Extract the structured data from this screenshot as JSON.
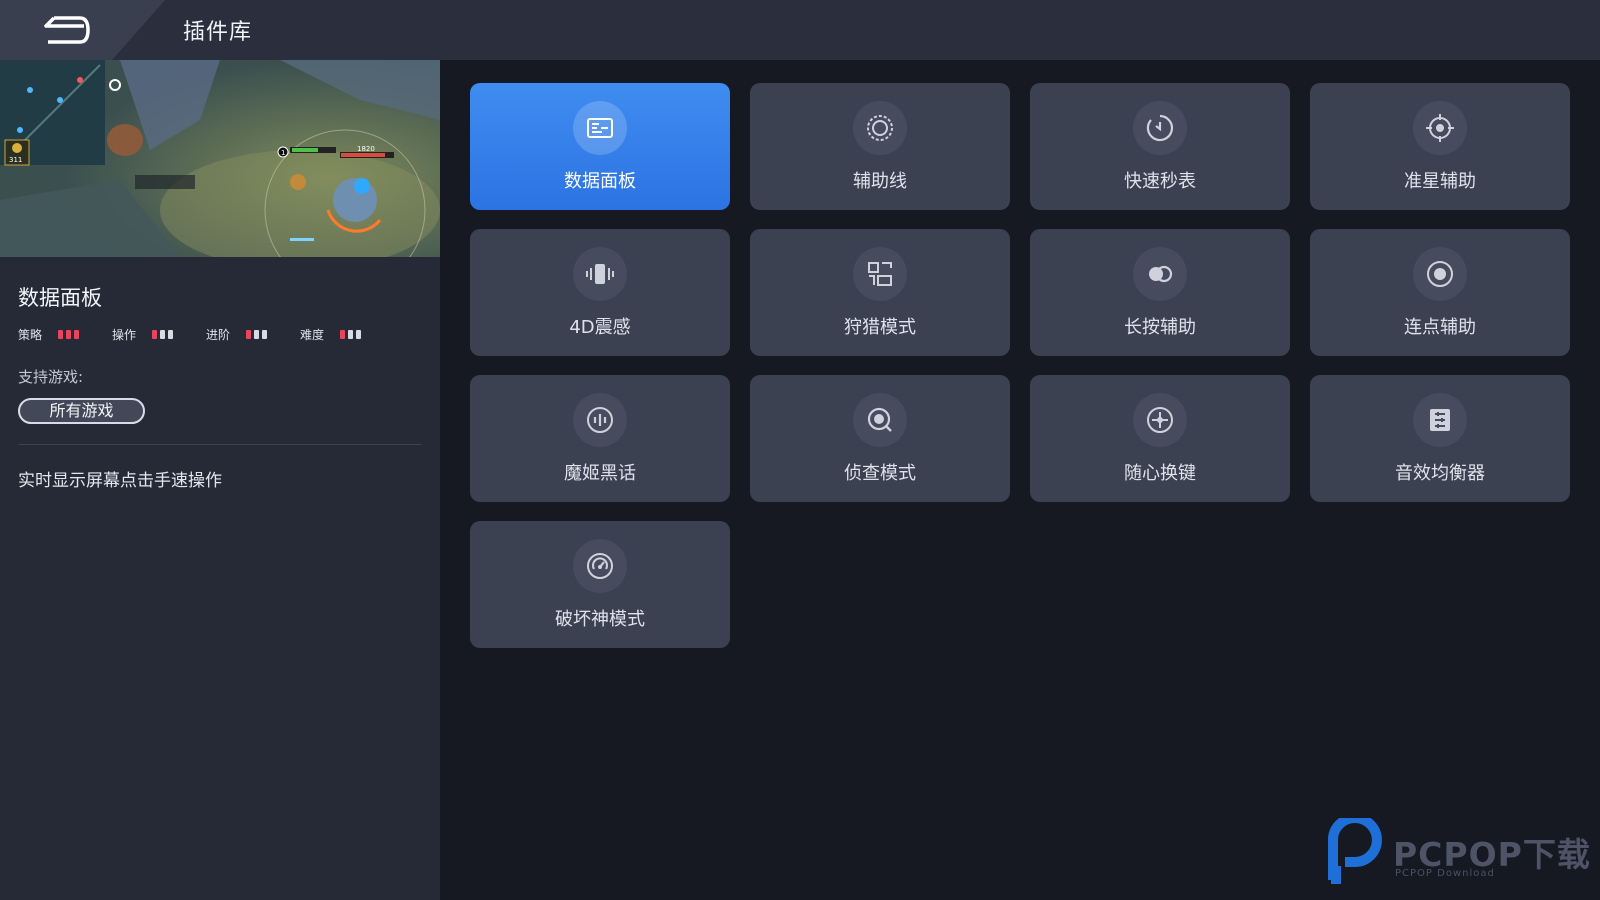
{
  "header": {
    "title": "插件库"
  },
  "detail": {
    "title": "数据面板",
    "ratings": [
      {
        "label": "策略",
        "level": 3,
        "max": 3
      },
      {
        "label": "操作",
        "level": 1,
        "max": 3
      },
      {
        "label": "进阶",
        "level": 1,
        "max": 3
      },
      {
        "label": "难度",
        "level": 1,
        "max": 3
      }
    ],
    "support_label": "支持游戏:",
    "game_chip": "所有游戏",
    "description": "实时显示屏幕点击手速操作",
    "preview_texts": {
      "hp_value": "1820",
      "gold": "311",
      "level": "1"
    }
  },
  "plugins": [
    {
      "label": "数据面板",
      "icon": "data-panel-icon",
      "active": true
    },
    {
      "label": "辅助线",
      "icon": "aux-line-icon",
      "active": false
    },
    {
      "label": "快速秒表",
      "icon": "stopwatch-icon",
      "active": false
    },
    {
      "label": "准星辅助",
      "icon": "crosshair-icon",
      "active": false
    },
    {
      "label": "4D震感",
      "icon": "vibration-icon",
      "active": false
    },
    {
      "label": "狩猎模式",
      "icon": "hunt-mode-icon",
      "active": false
    },
    {
      "label": "长按辅助",
      "icon": "long-press-icon",
      "active": false
    },
    {
      "label": "连点辅助",
      "icon": "auto-click-icon",
      "active": false
    },
    {
      "label": "魔姬黑话",
      "icon": "voice-changer-icon",
      "active": false
    },
    {
      "label": "侦查模式",
      "icon": "scout-mode-icon",
      "active": false
    },
    {
      "label": "随心换键",
      "icon": "key-remap-icon",
      "active": false
    },
    {
      "label": "音效均衡器",
      "icon": "equalizer-icon",
      "active": false
    },
    {
      "label": "破坏神模式",
      "icon": "destroyer-mode-icon",
      "active": false
    }
  ],
  "colors": {
    "accent": "#3585ec",
    "rating_on": "#e8445a",
    "rating_off": "#d8dbe4",
    "card_bg": "#3c4152"
  },
  "watermark": {
    "brand": "PCPOP下载",
    "sub": "PCPOP Download"
  }
}
